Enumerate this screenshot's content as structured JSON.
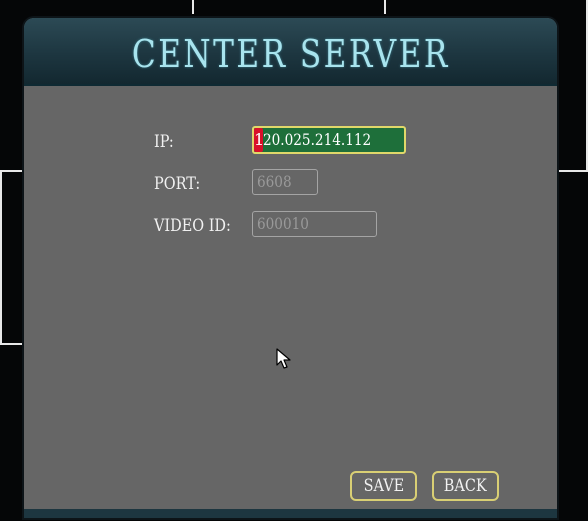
{
  "dialog": {
    "title": "CENTER SERVER"
  },
  "fields": {
    "ip": {
      "label": "IP:",
      "value_first_char": "1",
      "value_rest": "20.025.214.112"
    },
    "port": {
      "label": "PORT:",
      "value": "6608"
    },
    "video_id": {
      "label": "VIDEO ID:",
      "value": "600010"
    }
  },
  "buttons": {
    "save": "SAVE",
    "back": "BACK"
  },
  "colors": {
    "panel": "#666666",
    "title_bar": "#1d3640",
    "title_text": "#a8e4ee",
    "ip_field_bg": "#1e6f3a",
    "ip_caret": "#d8102a",
    "button_border": "#d9cf74"
  },
  "icons": {
    "cursor": "mouse-pointer-icon"
  }
}
